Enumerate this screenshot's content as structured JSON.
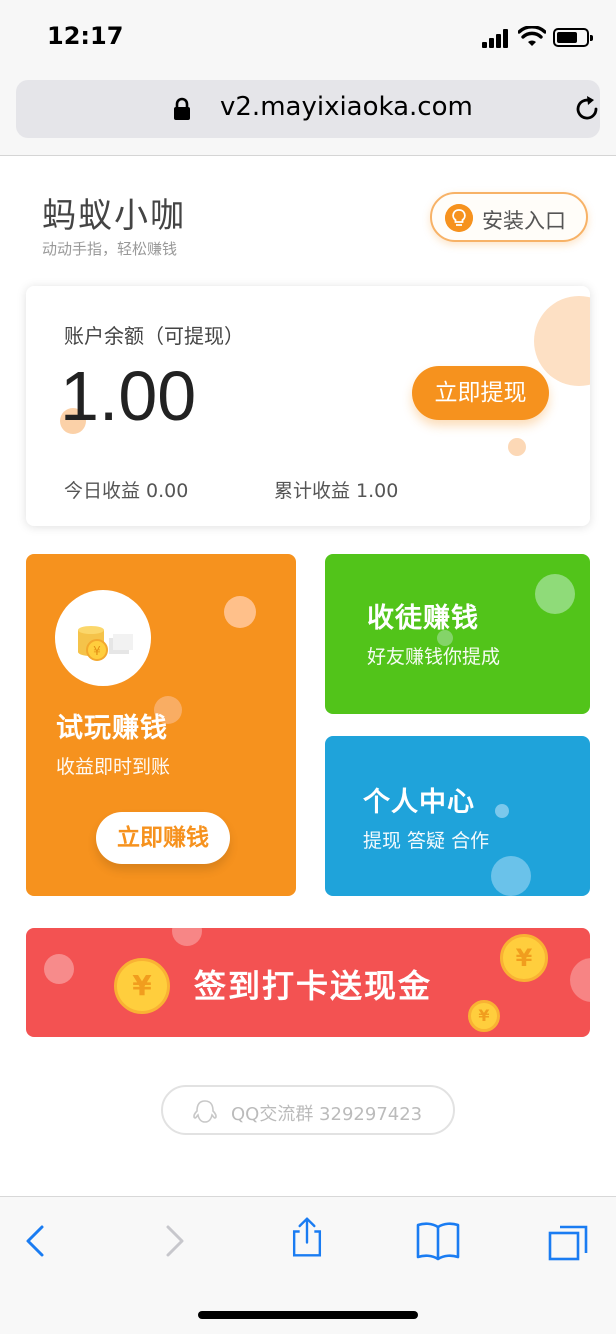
{
  "status": {
    "time": "12:17"
  },
  "browser": {
    "url": "v2.mayixiaoka.com"
  },
  "header": {
    "app_name": "蚂蚁小咖",
    "slogan": "动动手指，轻松赚钱",
    "install_label": "安装入口"
  },
  "balance": {
    "title": "账户余额（可提现）",
    "amount": "1.00",
    "withdraw_label": "立即提现",
    "today": "今日收益 0.00",
    "total": "累计收益 1.00"
  },
  "tiles": {
    "trial": {
      "title": "试玩赚钱",
      "subtitle": "收益即时到账",
      "button": "立即赚钱"
    },
    "invite": {
      "title": "收徒赚钱",
      "subtitle": "好友赚钱你提成"
    },
    "profile": {
      "title": "个人中心",
      "subtitle": "提现 答疑 合作"
    }
  },
  "checkin": {
    "label": "签到打卡送现金"
  },
  "qq_group": {
    "label": "QQ交流群 329297423"
  },
  "colors": {
    "orange": "#f6921e",
    "green": "#52c41a",
    "blue": "#1fa3da",
    "red": "#f35252",
    "ios_blue": "#1a7cf2"
  },
  "icons": [
    "lock-icon",
    "reload-icon",
    "bulb-icon",
    "coin-stack-icon",
    "yuan-coin-icon",
    "qq-icon",
    "back-icon",
    "forward-icon",
    "share-icon",
    "bookmarks-icon",
    "tabs-icon"
  ]
}
